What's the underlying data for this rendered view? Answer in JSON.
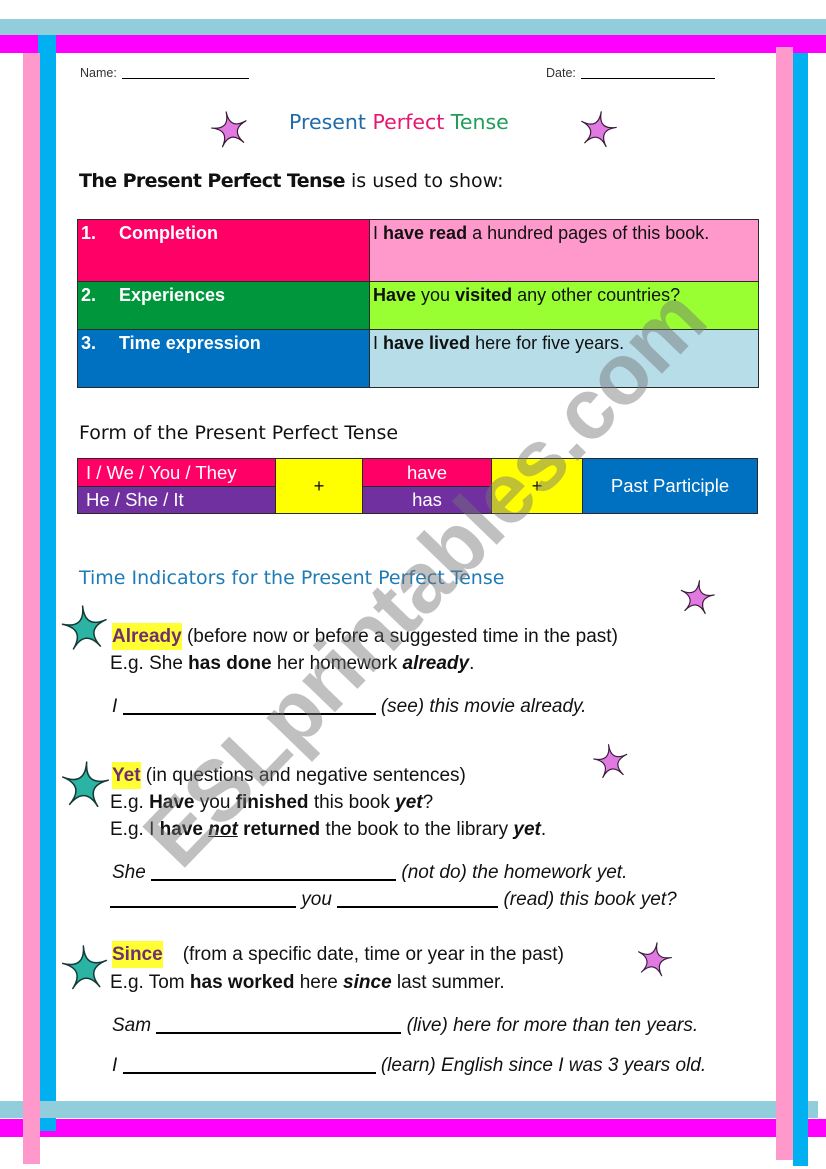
{
  "colors": {
    "frame_light_blue": "#92cddc",
    "frame_magenta": "#ff00ff",
    "frame_pink": "#ff99cc",
    "frame_blue": "#00b0f0",
    "title_present": "#1f6aaa",
    "title_perfect": "#e5186f",
    "title_tense": "#1f9e5a",
    "heading_teal_blue": "#1f7bb5",
    "crimson": "#ff0066",
    "light_pink": "#ff99cc",
    "green": "#00963c",
    "lime": "#99ff33",
    "blue": "#0070c0",
    "light_blue": "#b7dde8",
    "purple": "#7030a0",
    "yellow": "#ffff00",
    "highlight_yellow": "#ffff33",
    "term_purple": "#6f2f6f",
    "star_pink": "#e07ae0",
    "star_teal": "#2bb3a3"
  },
  "header": {
    "name_label": "Name:",
    "date_label": "Date:"
  },
  "title": {
    "words": [
      "Present",
      "Perfect",
      "Tense"
    ]
  },
  "uses": {
    "heading_emphasis": "The Present Perfect Tense",
    "heading_rest": " is used to show:",
    "rows": [
      {
        "number": "1.",
        "label": "Completion",
        "example": [
          "I ",
          "have read",
          " a hundred pages of this book."
        ]
      },
      {
        "number": "2.",
        "label": "Experiences",
        "example": [
          "Have",
          " you ",
          "visited",
          " any other countries?"
        ]
      },
      {
        "number": "3.",
        "label": "Time expression",
        "example": [
          "I ",
          "have lived",
          " here for five years."
        ]
      }
    ]
  },
  "form": {
    "heading": "Form of the Present Perfect Tense",
    "subjects": [
      "I / We / You / They",
      "He / She / It"
    ],
    "plus": "+",
    "auxiliaries": [
      "have",
      "has"
    ],
    "participle": "Past Participle"
  },
  "indicators": {
    "heading": "Time Indicators for the Present Perfect Tense",
    "already": {
      "term": "Already",
      "explanation": " (before now or before a suggested time in the past)",
      "example": [
        "E.g. She ",
        "has done",
        " her homework ",
        "already",
        "."
      ],
      "exercise": {
        "before": "I ",
        "after": " (see) this movie already."
      }
    },
    "yet": {
      "term": "Yet",
      "explanation": " (in questions and negative sentences)",
      "example1": [
        "E.g. ",
        "Have",
        " you ",
        "finished",
        " this book ",
        "yet",
        "?"
      ],
      "example2": [
        "E.g. I ",
        "have",
        " ",
        "not",
        " ",
        "returned",
        " the book to the library ",
        "yet",
        "."
      ],
      "exercise1": {
        "before": "She ",
        "after": " (not do) the homework yet."
      },
      "exercise2": {
        "middle": " you ",
        "after": " (read) this book yet?"
      }
    },
    "since": {
      "term": "Since",
      "explanation": "(from a specific date, time or year in the past)",
      "example": [
        "E.g. Tom ",
        "has worked",
        " here ",
        "since",
        " last summer."
      ],
      "exercise1": {
        "before": "Sam ",
        "after": " (live) here for more than ten years."
      },
      "exercise2": {
        "before": "I ",
        "after": " (learn) English since I was 3 years old."
      }
    }
  },
  "watermark": "ESLprintables.com"
}
